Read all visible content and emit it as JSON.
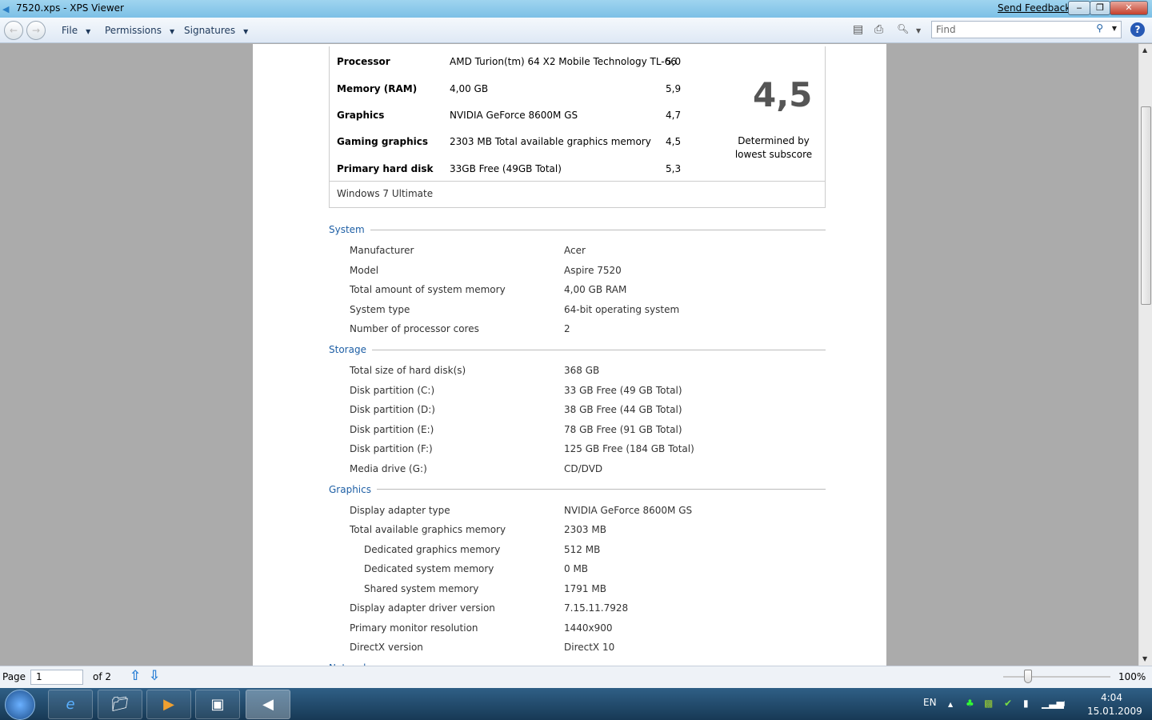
{
  "window": {
    "title": "7520.xps - XPS Viewer",
    "send_feedback": "Send Feedback"
  },
  "toolbar": {
    "menus": [
      "File",
      "Permissions",
      "Signatures"
    ],
    "find_placeholder": "Find",
    "zoom_icon_label": "100"
  },
  "score_table": {
    "rows": [
      {
        "component": "Processor",
        "detail": "AMD Turion(tm) 64 X2 Mobile Technology TL-66",
        "score": "5,0"
      },
      {
        "component": "Memory (RAM)",
        "detail": "4,00 GB",
        "score": "5,9"
      },
      {
        "component": "Graphics",
        "detail": "NVIDIA GeForce 8600M GS",
        "score": "4,7"
      },
      {
        "component": "Gaming graphics",
        "detail": "2303 MB Total available graphics memory",
        "score": "4,5"
      },
      {
        "component": "Primary hard disk",
        "detail": "33GB Free (49GB Total)",
        "score": "5,3"
      }
    ],
    "base_score": "4,5",
    "determined": "Determined by",
    "lowest": "lowest subscore",
    "os": "Windows 7 Ultimate"
  },
  "sections": [
    {
      "title": "System",
      "rows": [
        {
          "k": "Manufacturer",
          "v": "Acer"
        },
        {
          "k": "Model",
          "v": "Aspire 7520"
        },
        {
          "k": "Total amount of system memory",
          "v": "4,00 GB RAM"
        },
        {
          "k": "System type",
          "v": "64-bit operating system"
        },
        {
          "k": "Number of processor cores",
          "v": "2"
        }
      ]
    },
    {
      "title": "Storage",
      "rows": [
        {
          "k": "Total size of hard disk(s)",
          "v": "368 GB"
        },
        {
          "k": "Disk partition (C:)",
          "v": "33 GB Free (49 GB Total)"
        },
        {
          "k": "Disk partition (D:)",
          "v": "38 GB Free (44 GB Total)"
        },
        {
          "k": "Disk partition (E:)",
          "v": "78 GB Free (91 GB Total)"
        },
        {
          "k": "Disk partition (F:)",
          "v": "125 GB Free (184 GB Total)"
        },
        {
          "k": "Media drive (G:)",
          "v": "CD/DVD"
        }
      ]
    },
    {
      "title": "Graphics",
      "rows": [
        {
          "k": "Display adapter type",
          "v": "NVIDIA GeForce 8600M GS"
        },
        {
          "k": "Total available graphics memory",
          "v": "2303 MB"
        },
        {
          "k": "Dedicated graphics memory",
          "v": "512 MB",
          "indent": true
        },
        {
          "k": "Dedicated system memory",
          "v": "0 MB",
          "indent": true
        },
        {
          "k": "Shared system memory",
          "v": "1791 MB",
          "indent": true
        },
        {
          "k": "Display adapter driver version",
          "v": "7.15.11.7928"
        },
        {
          "k": "Primary monitor resolution",
          "v": "1440x900"
        },
        {
          "k": "DirectX version",
          "v": "DirectX 10"
        }
      ]
    },
    {
      "title": "Network",
      "rows": []
    }
  ],
  "status": {
    "page_label": "Page",
    "page_value": "1",
    "of": "of 2",
    "zoom": "100%",
    "zoom_percent": 100
  },
  "taskbar": {
    "lang": "EN",
    "time": "4:04",
    "date": "15.01.2009"
  }
}
